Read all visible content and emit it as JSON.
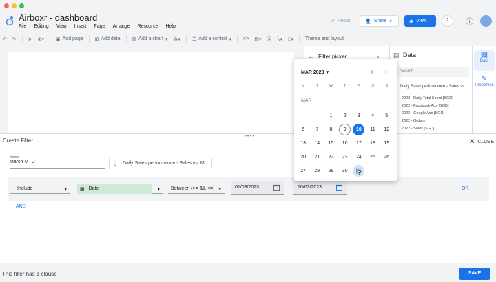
{
  "colors": {
    "accent": "#1a73e8",
    "date_chip": "#ceead6",
    "close_dot": "#ff5f57",
    "min_dot": "#febc2e",
    "max_dot": "#28c840"
  },
  "app": {
    "title": "Airboxr - dashboard"
  },
  "menu": [
    "File",
    "Editing",
    "View",
    "Insert",
    "Page",
    "Arrange",
    "Resource",
    "Help"
  ],
  "header": {
    "reset": "Reset",
    "share": "Share",
    "view": "View"
  },
  "toolbar": {
    "add_page": "Add page",
    "add_data": "Add data",
    "add_chart": "Add a chart",
    "add_control": "Add a control",
    "theme": "Theme and layout"
  },
  "filter_picker": {
    "title": "Filter picker"
  },
  "data_panel": {
    "title": "Data",
    "search_placeholder": "Search",
    "source": "Daily Sales performance - Sales vs...",
    "fields": [
      "2022 - Daily Total Spent [SGD]",
      "2022 - Facebook Ads [SGD]",
      "2022 - Google Ads [SGD]",
      "2022 - Orders",
      "2022 - Sales [SGD]"
    ]
  },
  "rail": {
    "data": "Data",
    "properties": "Properties"
  },
  "create_filter": {
    "title": "Create Filter",
    "close": "CLOSE",
    "name_label": "Name",
    "name_value": "March MTD",
    "data_source": "Daily Sales performance - Sales vs. M...",
    "include": "Include",
    "field": "Date",
    "operator": "Between (>= && <=)",
    "date_from": "01/03/2023",
    "date_to": "10/03/2023",
    "or": "OR",
    "and": "AND",
    "footer": "This filter has 1 clause",
    "save": "SAVE"
  },
  "calendar": {
    "header": "MAR 2023",
    "dow": [
      "M",
      "T",
      "W",
      "T",
      "F",
      "S",
      "S"
    ],
    "month_label": "MAR",
    "offset": 2,
    "days": [
      "1",
      "2",
      "3",
      "4",
      "5",
      "6",
      "7",
      "8",
      "9",
      "10",
      "11",
      "12",
      "13",
      "14",
      "15",
      "16",
      "17",
      "18",
      "19",
      "20",
      "21",
      "22",
      "23",
      "24",
      "25",
      "26",
      "27",
      "28",
      "29",
      "30",
      "31"
    ],
    "today": "9",
    "selected": "10",
    "hover": "31"
  }
}
